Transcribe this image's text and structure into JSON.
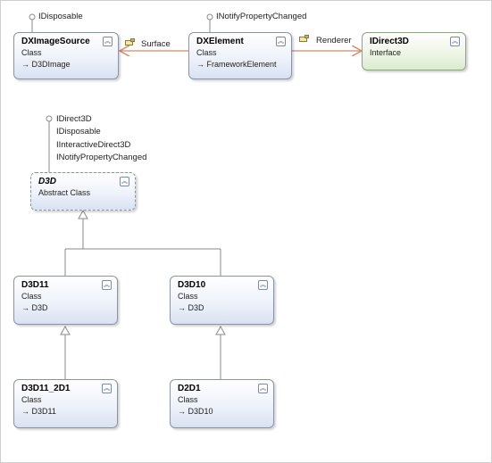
{
  "diagram": {
    "boxes": [
      {
        "id": "dximagesource",
        "title": "DXImageSource",
        "kind": "Class",
        "base": "D3DImage",
        "lollipops": [
          "IDisposable"
        ]
      },
      {
        "id": "dxelement",
        "title": "DXElement",
        "kind": "Class",
        "base": "FrameworkElement",
        "lollipops": [
          "INotifyPropertyChanged"
        ]
      },
      {
        "id": "idirect3d",
        "title": "IDirect3D",
        "kind": "Interface",
        "base": "",
        "lollipops": []
      },
      {
        "id": "d3d",
        "title": "D3D",
        "kind": "Abstract Class",
        "base": "",
        "lollipops": [
          "IDirect3D",
          "IDisposable",
          "IInteractiveDirect3D",
          "INotifyPropertyChanged"
        ]
      },
      {
        "id": "d3d11",
        "title": "D3D11",
        "kind": "Class",
        "base": "D3D",
        "lollipops": []
      },
      {
        "id": "d3d10",
        "title": "D3D10",
        "kind": "Class",
        "base": "D3D",
        "lollipops": []
      },
      {
        "id": "d3d11_2d1",
        "title": "D3D11_2D1",
        "kind": "Class",
        "base": "D3D11",
        "lollipops": []
      },
      {
        "id": "d2d1",
        "title": "D2D1",
        "kind": "Class",
        "base": "D3D10",
        "lollipops": []
      }
    ],
    "associations": [
      {
        "label": "Surface",
        "from": "DXElement",
        "to": "DXImageSource"
      },
      {
        "label": "Renderer",
        "from": "DXElement",
        "to": "IDirect3D"
      }
    ],
    "inheritance": [
      {
        "child": "D3D11",
        "parent": "D3D"
      },
      {
        "child": "D3D10",
        "parent": "D3D"
      },
      {
        "child": "D3D11_2D1",
        "parent": "D3D11"
      },
      {
        "child": "D2D1",
        "parent": "D3D10"
      }
    ],
    "colors": {
      "line": "#8a8a8a",
      "association": "#d08a6e",
      "box_border": "#8a93a7"
    },
    "expander_glyph": "chevron-collapse-icon"
  }
}
